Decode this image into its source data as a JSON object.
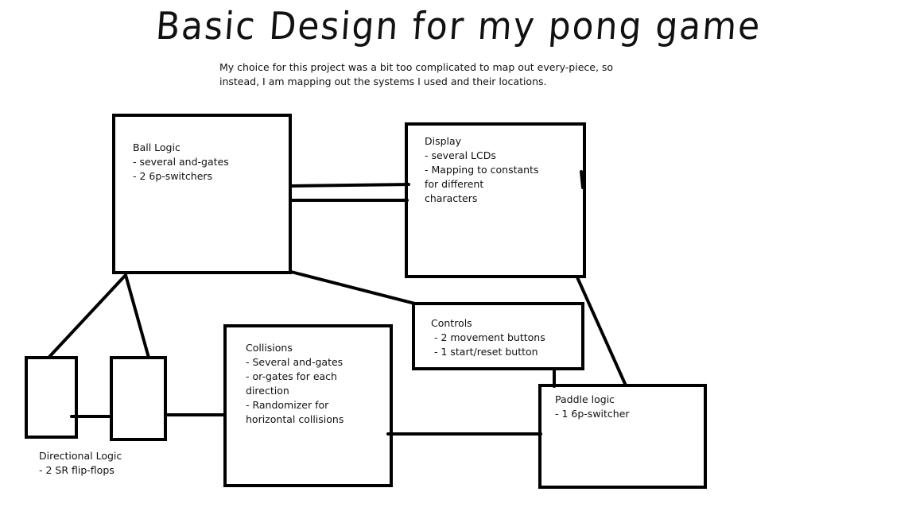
{
  "title": "Basic Design for my pong game",
  "subtitle": "My choice for this project was a bit too complicated to map out every-piece, so instead, I am mapping out the systems I used and their locations.",
  "nodes": {
    "ball_logic": {
      "name": "Ball Logic",
      "lines": [
        "- several and-gates",
        "- 2 6p-switchers"
      ]
    },
    "display": {
      "name": "Display",
      "lines": [
        "- several LCDs",
        "- Mapping to constants",
        "for different",
        "characters"
      ]
    },
    "controls": {
      "name": "Controls",
      "lines": [
        " - 2 movement buttons",
        " - 1 start/reset button"
      ]
    },
    "collisions": {
      "name": "Collisions",
      "lines": [
        "- Several and-gates",
        "- or-gates for each",
        "direction",
        "- Randomizer for",
        "horizontal collisions"
      ]
    },
    "paddle_logic": {
      "name": "Paddle logic",
      "lines": [
        "- 1 6p-switcher"
      ]
    },
    "directional_logic": {
      "name": "Directional Logic",
      "lines": [
        "- 2 SR flip-flops"
      ]
    }
  }
}
